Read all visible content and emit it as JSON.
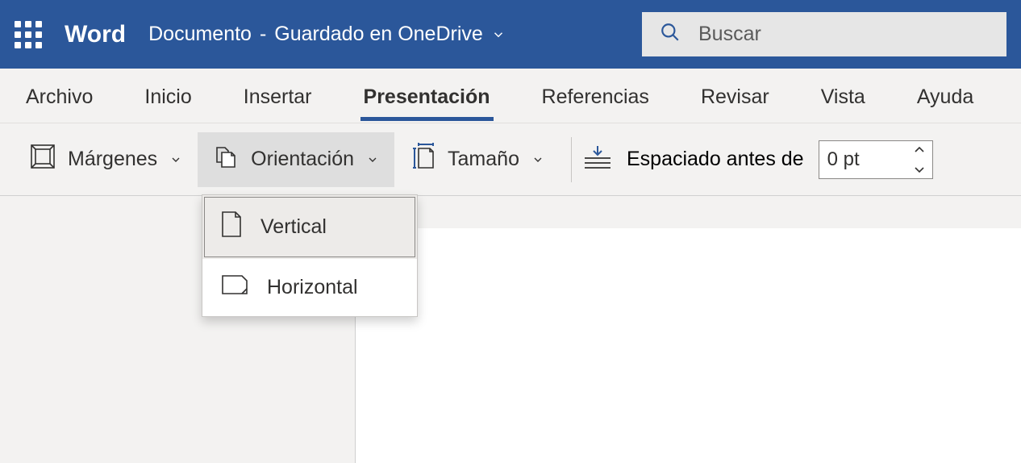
{
  "titlebar": {
    "app_name": "Word",
    "doc_name": "Documento",
    "save_status": "Guardado en OneDrive"
  },
  "search": {
    "placeholder": "Buscar"
  },
  "tabs": {
    "archivo": "Archivo",
    "inicio": "Inicio",
    "insertar": "Insertar",
    "presentacion": "Presentación",
    "referencias": "Referencias",
    "revisar": "Revisar",
    "vista": "Vista",
    "ayuda": "Ayuda"
  },
  "ribbon": {
    "margenes": "Márgenes",
    "orientacion": "Orientación",
    "tamano": "Tamaño",
    "espaciado_antes": "Espaciado antes de",
    "espaciado_value": "0 pt"
  },
  "orientation_menu": {
    "vertical": "Vertical",
    "horizontal": "Horizontal"
  }
}
